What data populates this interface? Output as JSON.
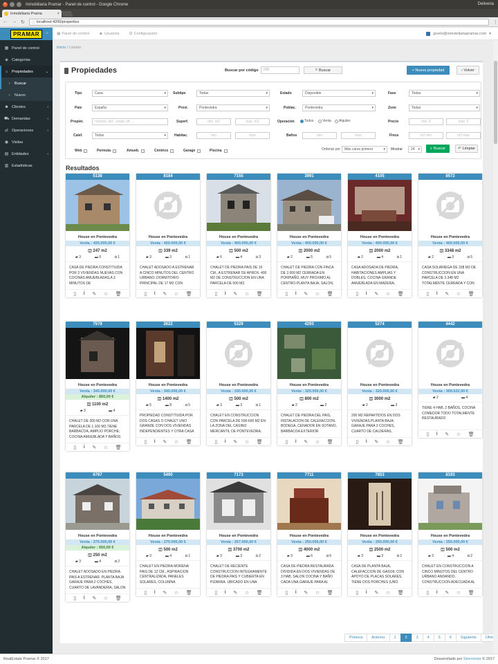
{
  "browser": {
    "window_title": "Inmobiliaria Pramar - Panel de control - Google Chrome",
    "tab_title": "Inmobiliaria Prama",
    "url": "localhost:4200/properties",
    "time": "Deliveria"
  },
  "sidebar": {
    "logo": "PRAMAR",
    "items": [
      {
        "label": "Panel de control",
        "icon": "dashboard-icon"
      },
      {
        "label": "Categorías",
        "icon": "tag-icon"
      },
      {
        "label": "Propiedades",
        "icon": "home-icon"
      },
      {
        "label": "Buscar",
        "icon": "chevron-icon"
      },
      {
        "label": "Nuevo",
        "icon": "chevron-icon"
      },
      {
        "label": "Clientes",
        "icon": "users-icon"
      },
      {
        "label": "Demandas",
        "icon": "cart-icon"
      },
      {
        "label": "Operaciones",
        "icon": "ops-icon"
      },
      {
        "label": "Visitas",
        "icon": "eye-icon"
      },
      {
        "label": "Entidades",
        "icon": "building-icon"
      },
      {
        "label": "Estadísticas",
        "icon": "stats-icon"
      }
    ]
  },
  "topbar": {
    "links": [
      "Panel de control",
      "Usuarios",
      "Configuración"
    ],
    "user": "jpvelo@inmobiliariapramar.com"
  },
  "breadcrumb": {
    "home": "Inicio",
    "current": "Listado"
  },
  "page": {
    "title": "Propiedades",
    "code_label": "Buscar por código",
    "code_placeholder": "000",
    "code_button": "Buscar",
    "new_button": "+ Nueva propiedad",
    "back_button": "Volver",
    "results_title": "Resultados"
  },
  "filters": {
    "tipo": {
      "label": "Tipo",
      "value": "Casa"
    },
    "subtipo": {
      "label": "Subtipo",
      "value": "Todas"
    },
    "estado": {
      "label": "Estado",
      "value": "Disponible"
    },
    "fase": {
      "label": "Fase",
      "value": "Todas"
    },
    "pais": {
      "label": "País",
      "value": "España"
    },
    "provi": {
      "label": "Provi.",
      "value": "Pontevedra"
    },
    "poblac": {
      "label": "Poblac.",
      "value": "Pontevedra"
    },
    "zone": {
      "label": "Zone",
      "value": "Todas"
    },
    "propiet": {
      "label": "Propiet.",
      "placeholder": "nombre, tlef., email, nif, ..."
    },
    "superf": {
      "label": "Superf.",
      "min": "min. m2",
      "max": "max. m2"
    },
    "operacion": {
      "label": "Operación",
      "options": [
        "Todos",
        "Venta",
        "Alquiler"
      ]
    },
    "precio": {
      "label": "Precio",
      "min": "min. €",
      "max": "max. €"
    },
    "calef": {
      "label": "Calef.",
      "value": "Todas"
    },
    "habitac": {
      "label": "Habitac.",
      "min": "min",
      "max": "max"
    },
    "banos": {
      "label": "Baños",
      "min": "min",
      "max": "max"
    },
    "finca": {
      "label": "Finca",
      "min": "m2 min",
      "max": "m2 max"
    },
    "checks": [
      "Web",
      "Permuta",
      "Amueb.",
      "Céntrico",
      "Garage",
      "Piscina"
    ],
    "order_label": "Ordenar por",
    "order_value": "Más caros primero",
    "show_label": "Mostrar",
    "show_value": "24",
    "search_button": "Buscar",
    "clear_button": "Limpiar"
  },
  "properties": [
    {
      "code": "5138",
      "title": "House en Pontevedra",
      "sale": "Venta : 425.000,00 €",
      "rent": "",
      "area": "247 m2",
      "beds": "3",
      "baths": "9",
      "garage": "1",
      "desc": "CASA DE PIEDRA CONSTITUIDA POR 3 VIVIENDAS NUEVAS CON COCINAS AMUEBLADAS,A 3 MINUTOS DE",
      "img": "photo-a"
    },
    {
      "code": "8184",
      "title": "House en Pontevedra",
      "sale": "Venta : 420.000,00 €",
      "rent": "",
      "area": "339 m2",
      "beds": "3",
      "baths": "3",
      "garage": "1",
      "desc": "CHALET ADOSADO A ESTRENAR A CINCO MINUTOS DEL CENTRO URBANO. DORMITORIO PRINCIPAL DE 17 M2 CON",
      "img": "none"
    },
    {
      "code": "7155",
      "title": "House en Pontevedra",
      "sale": "Venta : 400.000,00 €",
      "rent": "",
      "area": "500 m2",
      "beds": "6",
      "baths": "4",
      "garage": "3",
      "desc": "CHALET DE PIEDRA PAIS DE 10 CM., A ESTRENAR DE APROX. 400 M2 DE CONSTRUCCION EN UNA PARCELA DE 500 M2.",
      "img": "photo-b"
    },
    {
      "code": "3991",
      "title": "House en Pontevedra",
      "sale": "Venta : 400.000,00 €",
      "rent": "",
      "area": "2000 m2",
      "beds": "2",
      "baths": "5",
      "garage": "5",
      "desc": "CHALET DE PIEDRA CON FINCA DE 2.000 M2 CERRADA EN PORPIAÑO, MUY PROXIMO AL CENTRO.PLANTA BAJA, SALON,",
      "img": "photo-c"
    },
    {
      "code": "4105",
      "title": "House en Pontevedra",
      "sale": "Venta : 400.000,00 €",
      "rent": "",
      "area": "2000 m2",
      "beds": "2",
      "baths": "4",
      "garage": "1",
      "desc": "CASA ADOSADA DE PIEDRA, HABITACIONES AMPLIAS Y DOBLES, COCINA GRANDE AMUEBLADA EN MADERA,",
      "img": "photo-d"
    },
    {
      "code": "8572",
      "title": "House en Pontevedra",
      "sale": "Venta : 400.000,00 €",
      "rent": "",
      "area": "3348 m2",
      "beds": "2",
      "baths": "3",
      "garage": "5",
      "desc": "CASA SOLARIEGA DE 338 M2 DE CONSTRUCCION EN UNA PARCELA DE 3.348 M2 TOTALMENTE CERRADA Y CON",
      "img": "none"
    },
    {
      "code": "7579",
      "title": "House en Pontevedra",
      "sale": "Venta : 340.000,00 €",
      "rent": "Alquiler : 850,00 €",
      "area": "1100 m2",
      "beds": "3",
      "baths": "4",
      "garage": "",
      "desc": "CHALET DE 300 M2 CON UNA PARCELA DE 1.100 M2.TIENE BARBACOA, AMPLIO PORCHE; COCINA AMUEBLADA Y BAÑOS",
      "img": "photo-e"
    },
    {
      "code": "2622",
      "title": "House en Pontevedra",
      "sale": "Venta : 340.000,00 €",
      "rent": "",
      "area": "1400 m2",
      "beds": "5",
      "baths": "8",
      "garage": "5",
      "desc": "PROPIEDAD CONSTITUIDA POR DOS CASAS O CHALET UNO GRANDE CON DOS VIVIENDAS INDEPENDIENTES Y OTRA CASA",
      "img": "photo-f"
    },
    {
      "code": "5329",
      "title": "House en Pontevedra",
      "sale": "Venta : 330.000,00 €",
      "rent": "",
      "area": "500 m2",
      "beds": "3",
      "baths": "3",
      "garage": "1",
      "desc": "CHALET EN CONSTRUCCION CON PARCELA DE 500-600 M2 EN LA ZONA DEL CASINO MERCANTIL DE PONTEVEDRA,",
      "img": "none"
    },
    {
      "code": "4293",
      "title": "House en Pontevedra",
      "sale": "Venta : 320.000,00 €",
      "rent": "",
      "area": "800 m2",
      "beds": "2",
      "baths": "2",
      "garage": "",
      "desc": "CHALET DE PIEDRA DEL PAIS, INSTALACION DE CALEFACCION, BODEGA, CENADOR EN SOTANO, BARBACOA EXTERIOR",
      "img": "photo-g"
    },
    {
      "code": "5274",
      "title": "House en Pontevedra",
      "sale": "Venta : 320.000,00 €",
      "rent": "",
      "area": "3000 m2",
      "beds": "2",
      "baths": "3",
      "garage": "",
      "desc": "200 M2 REPARTIDOS EN DOS VIVIENDAS.PLANTA BAJA: GARAJE PARA 3 COCHES, CUARTO DE CALDERAS,",
      "img": "none"
    },
    {
      "code": "4442",
      "title": "House en Pontevedra",
      "sale": "Venta : 309.522,00 €",
      "rent": "",
      "area": "",
      "beds": "2",
      "baths": "4",
      "garage": "",
      "desc": "TIENE 4 HAB, 2 BAÑOS, COCINA COMEDOR TODO TOTALMENTE RESTAURADO",
      "img": "none"
    },
    {
      "code": "6767",
      "title": "House en Pontevedra",
      "sale": "Venta : 275.000,00 €",
      "rent": "Alquiler : 650,00 €",
      "area": "250 m2",
      "beds": "3",
      "baths": "4",
      "garage": "2",
      "desc": "CHALET ADOSADO EN PIEDRA PAIS A ESTRENAR. PLANTA BAJA GARAJE PARA 2 COCHES, CUARTO DE LAVANDERIA, SALON",
      "img": "photo-h"
    },
    {
      "code": "5490",
      "title": "House en Pontevedra",
      "sale": "Venta : 270.000,00 €",
      "rent": "",
      "area": "500 m2",
      "beds": "3",
      "baths": "4",
      "garage": "1",
      "desc": "CHALET EN PIEDRA MORENA PAIS DE 12 CM., ASPIRACION CENTRALIZADA, PANELES SOLARES, COLUMNA",
      "img": "photo-i"
    },
    {
      "code": "7173",
      "title": "House en Pontevedra",
      "sale": "Venta : 257.000,00 €",
      "rent": "",
      "area": "3700 m2",
      "beds": "3",
      "baths": "3",
      "garage": "2",
      "desc": "CHALET DE RECIENTE CONSTRUCCION INTEGRAMENTE DE PIEDRA PAIS Y CUBIERTA EN PIZARRA. UBICADO EN UNA",
      "img": "photo-j"
    },
    {
      "code": "7711",
      "title": "House en Pontevedra",
      "sale": "Venta : 250.000,00 €",
      "rent": "",
      "area": "4000 m2",
      "beds": "3",
      "baths": "6",
      "garage": "6",
      "desc": "CASA DE PIEDRA RESTAURADA DIVIDIDA EN DOS VIVIENDAS DE 3 HAB, SALON COCINA Y BAÑO CADA UNA.GARAJE PARA AL",
      "img": "photo-k"
    },
    {
      "code": "7853",
      "title": "House en Pontevedra",
      "sale": "Venta : 250.000,00 €",
      "rent": "",
      "area": "2500 m2",
      "beds": "3",
      "baths": "3",
      "garage": "2",
      "desc": "CASA DE PLANTA BAJA, CALEFACCION DE GASOIL CON APOYO DE PLACAS SOLARES, TIENE DOS PORCHES (UNO",
      "img": "photo-l"
    },
    {
      "code": "8193",
      "title": "House en Pontevedra",
      "sale": "Venta : 250.000,00 €",
      "rent": "",
      "area": "500 m2",
      "beds": "3",
      "baths": "4",
      "garage": "2",
      "desc": "CHALET EN CONSTRUCCION A CINCO MINUTOS DEL CENTRO URBANO ANDANDO. CONSTRUCCION ADECUADA AL",
      "img": "photo-m"
    }
  ],
  "pagination": [
    "Primera",
    "Anterior",
    "1",
    "2",
    "3",
    "4",
    "5",
    "6",
    "Siguiente",
    "Última"
  ],
  "pagination_active": "2",
  "footer": {
    "left": "RealEstate Pramar © 2017",
    "right_prefix": "Desarrollado por",
    "right_link": "Sincronize",
    "right_suffix": "© 2017"
  }
}
